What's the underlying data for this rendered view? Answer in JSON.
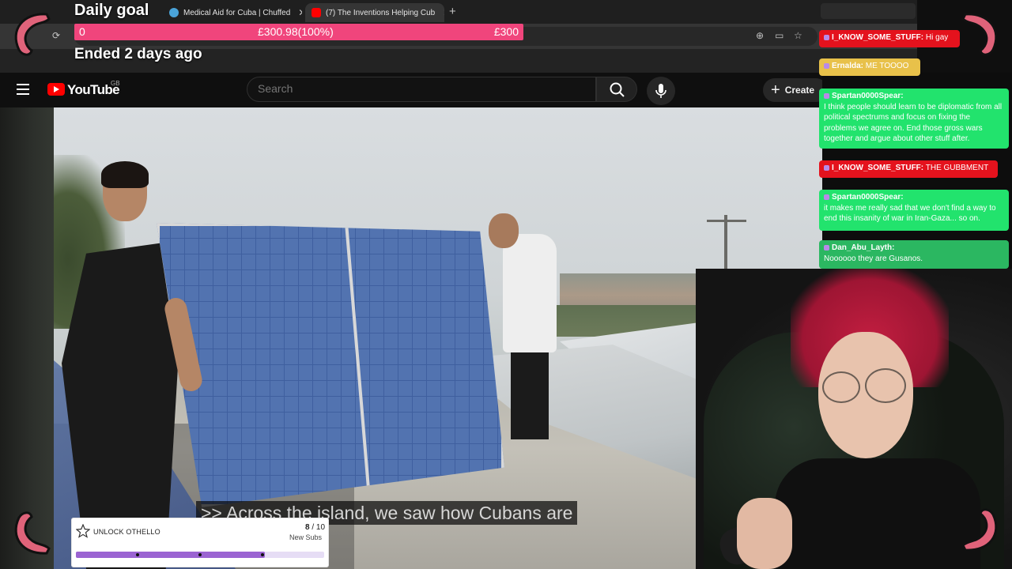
{
  "browser": {
    "tabs": [
      {
        "label": "Medical Aid for Cuba | Chuffed",
        "active": false
      },
      {
        "label": "(7) The Inventions Helping Cub",
        "active": true
      }
    ],
    "new_tab": "+"
  },
  "daily_goal": {
    "title": "Daily goal",
    "start": "0",
    "progress_text": "£300.98(100%)",
    "target": "£300",
    "ended": "Ended 2 days ago",
    "progress_fraction": 1.0
  },
  "youtube": {
    "brand": "YouTube",
    "region": "GB",
    "search_placeholder": "Search",
    "create_label": "Create",
    "subtitle": ">> Across the island, we saw how Cubans are"
  },
  "chat": {
    "messages": [
      {
        "user": "Ernalda:",
        "text": "ME TOOOO",
        "style": "yellow"
      },
      {
        "user": "I_KNOW_SOME_STUFF:",
        "text": "Hi gay",
        "style": "red"
      },
      {
        "user": "Spartan0000Spear:",
        "text": "I think people should learn to be diplomatic from all political spectrums and focus on fixing the problems we agree on. End those gross wars together and argue about other stuff after.",
        "style": "green"
      },
      {
        "user": "I_KNOW_SOME_STUFF:",
        "text": "THE GUBBMENT",
        "style": "red"
      },
      {
        "user": "Spartan0000Spear:",
        "text": "it makes me really sad that we don't find a way to end this insanity of war in Iran-Gaza... so on.",
        "style": "green"
      },
      {
        "user": "Dan_Abu_Layth:",
        "text": "Noooooo they are Gusanos.",
        "style": "teal"
      }
    ]
  },
  "sub_goal": {
    "title": "UNLOCK OTHELLO",
    "current": "8",
    "total": "/ 10",
    "label": "New Subs",
    "progress_fraction": 0.8
  },
  "colors": {
    "goal_bar": "#f0457c",
    "youtube_red": "#ff0000",
    "chat_red": "#e4121d",
    "chat_green": "#22e36d",
    "chat_yellow": "#e8c14a",
    "sub_fill": "#9b64d2"
  },
  "icons": [
    "hamburger-menu-icon",
    "youtube-logo-icon",
    "search-icon",
    "mic-icon",
    "plus-icon",
    "star-icon",
    "shrimp-icon",
    "reload-icon",
    "zoom-icon",
    "bookmark-star-icon"
  ]
}
